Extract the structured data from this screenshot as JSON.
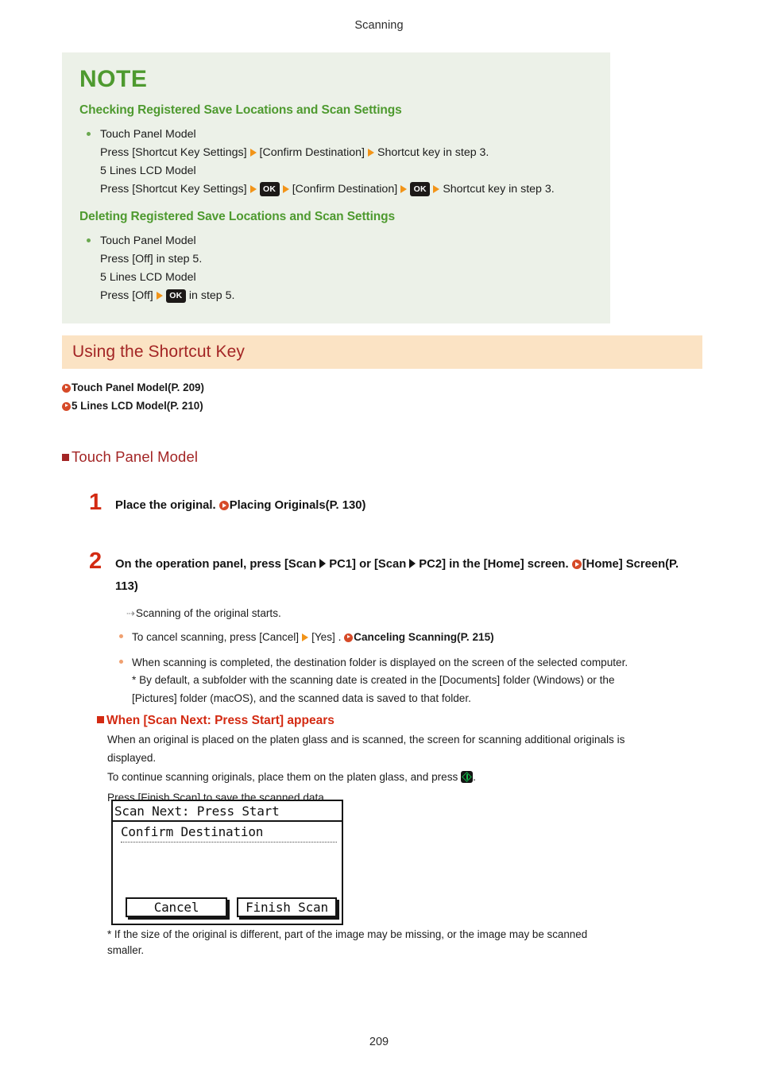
{
  "page": {
    "running_head": "Scanning",
    "page_number": "209"
  },
  "note": {
    "title": "NOTE",
    "sections": [
      {
        "heading": "Checking Registered Save Locations and Scan Settings",
        "model_a_label": "Touch Panel Model",
        "model_a_line_prefix": "Press [Shortcut Key Settings]",
        "model_a_line_mid": "[Confirm Destination]",
        "model_a_line_end": "Shortcut key in step 3.",
        "model_b_label": "5 Lines LCD Model",
        "model_b_line_prefix": "Press [Shortcut Key Settings]",
        "model_b_line_mid": "[Confirm Destination]",
        "model_b_line_end": "Shortcut key in step 3."
      },
      {
        "heading": "Deleting Registered Save Locations and Scan Settings",
        "model_a_label": "Touch Panel Model",
        "model_a_line": "Press [Off] in step 5.",
        "model_b_label": "5 Lines LCD Model",
        "model_b_line_prefix": "Press [Off]",
        "model_b_line_end": "in step 5."
      }
    ],
    "ok_key_label": "OK"
  },
  "section": {
    "banner_title": "Using the Shortcut Key",
    "toc": [
      "Touch Panel Model(P. 209)",
      "5 Lines LCD Model(P. 210)"
    ],
    "subheading": "Touch Panel Model"
  },
  "steps": [
    {
      "number": "1",
      "title_text": "Place the original.",
      "link_text": "Placing Originals(P. 130)"
    },
    {
      "number": "2",
      "title_part1": "On the operation panel, press [Scan",
      "title_part2": "PC1] or [Scan",
      "title_part3": "PC2] in the [Home] screen.",
      "link_text": "[Home] Screen(P. 113)",
      "result_note": "Scanning of the original starts.",
      "bullets": [
        {
          "prefix": "To cancel scanning, press [Cancel]",
          "mid": "[Yes] .",
          "link_text": "Canceling Scanning(P. 215)"
        },
        {
          "line1": "When scanning is completed, the destination folder is displayed on the screen of the selected computer.",
          "line2": "* By default, a subfolder with the scanning date is created in the [Documents] folder (Windows) or the",
          "line3": "[Pictures] folder (macOS), and the scanned data is saved to that folder."
        }
      ]
    }
  ],
  "appears": {
    "heading": "When [Scan Next: Press Start] appears",
    "line1": "When an original is placed on the platen glass and is scanned, the screen for scanning additional originals is",
    "line2": "displayed.",
    "line3_prefix": "To continue scanning originals, place them on the platen glass, and press",
    "line3_suffix": ".",
    "line4": "Press [Finish Scan] to save the scanned data."
  },
  "lcd": {
    "title": "Scan Next: Press Start",
    "item": "Confirm Destination",
    "cancel_button": "Cancel",
    "finish_button": "Finish Scan"
  },
  "footnote": {
    "line1": "* If the size of the original is different, part of the image may be missing, or the image may be scanned",
    "line2": "smaller."
  },
  "icons": {
    "arrow": "right-triangle-arrow",
    "ok": "ok-key-icon",
    "start": "start-key-icon",
    "link": "link-arrow-icon",
    "result": "result-arrow-icon"
  },
  "colors": {
    "note_bg": "#ecf1e8",
    "note_green": "#4e9a2f",
    "banner_bg": "#fbe3c4",
    "heading_red": "#a32525",
    "step_red": "#d32a12",
    "arrow_orange": "#f29418",
    "link_circle": "#d64a28",
    "bullet_orange": "#f0a070",
    "start_green": "#14b84a"
  }
}
